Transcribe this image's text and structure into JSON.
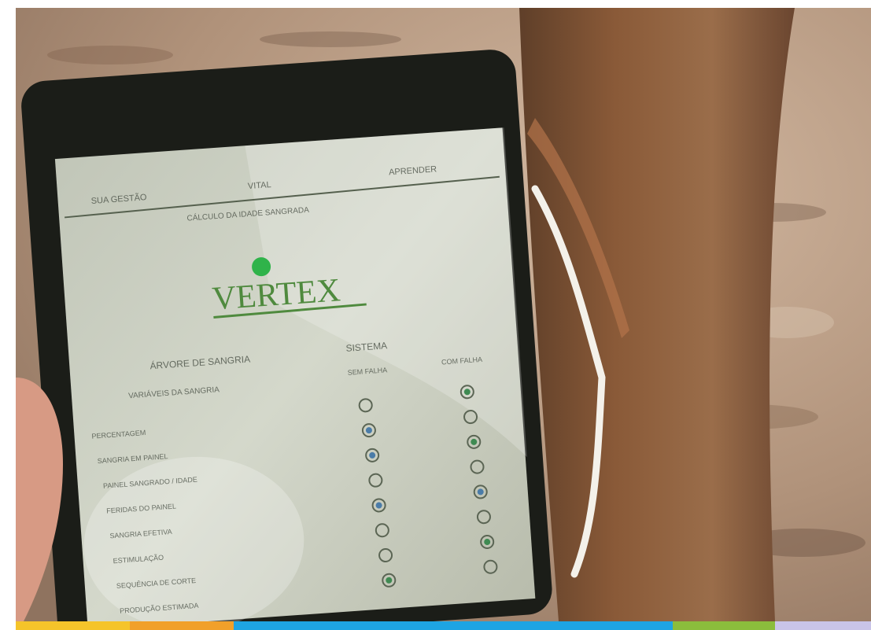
{
  "app": {
    "tabs": [
      "SUA GESTÃO",
      "VITAL",
      "APRENDER"
    ],
    "subtitle": "CÁLCULO DA IDADE SANGRADA",
    "logo": "VERTEX",
    "left_heading": "ÁRVORE DE SANGRIA",
    "left_column_header": "VARIÁVEIS DA SANGRIA",
    "right_heading": "SISTEMA",
    "right_column_header_a": "SEM FALHA",
    "right_column_header_b": "COM FALHA",
    "rows": [
      {
        "label": "PERCENTAGEM",
        "col_a": false,
        "col_b": true
      },
      {
        "label": "SANGRIA EM PAINEL",
        "col_a": true,
        "col_b": false
      },
      {
        "label": "PAINEL SANGRADO / IDADE",
        "col_a": true,
        "col_b": true
      },
      {
        "label": "FERIDAS DO PAINEL",
        "col_a": false,
        "col_b": false
      },
      {
        "label": "SANGRIA EFETIVA",
        "col_a": true,
        "col_b": true
      },
      {
        "label": "ESTIMULAÇÃO",
        "col_a": false,
        "col_b": false
      },
      {
        "label": "SEQUÊNCIA DE CORTE",
        "col_a": false,
        "col_b": true
      },
      {
        "label": "PRODUÇÃO ESTIMADA",
        "col_a": true,
        "col_b": false
      }
    ]
  },
  "colors": {
    "screen": "#c9cdbe",
    "logo_green": "#4f8a3e",
    "logo_dot": "#2fb34a",
    "bark": "#8a5a38",
    "latex": "#f4f1ea",
    "ground": "#b79d86"
  },
  "band_colors": [
    "#f5c42a",
    "#f1a02a",
    "#1ea4e3",
    "#8bbd3c",
    "#c9c4e8"
  ]
}
